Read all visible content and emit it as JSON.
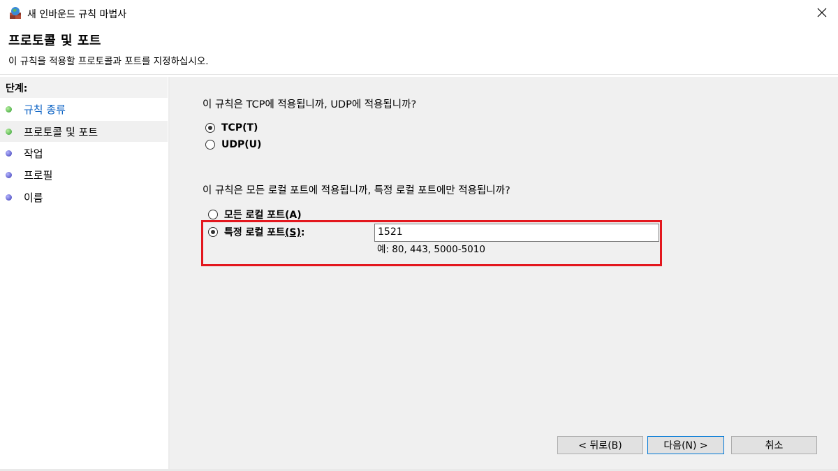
{
  "window": {
    "title": "새 인바운드 규칙 마법사",
    "close_label": "✕"
  },
  "header": {
    "title": "프로토콜 및 포트",
    "subtitle": "이 규칙을 적용할 프로토콜과 포트를 지정하십시오."
  },
  "steps": {
    "label": "단계:",
    "items": [
      {
        "label": "규칙 종류",
        "status": "done",
        "color": "green"
      },
      {
        "label": "프로토콜 및 포트",
        "status": "current",
        "color": "green"
      },
      {
        "label": "작업",
        "status": "pending",
        "color": "blue"
      },
      {
        "label": "프로필",
        "status": "pending",
        "color": "blue"
      },
      {
        "label": "이름",
        "status": "pending",
        "color": "blue"
      }
    ]
  },
  "protocol": {
    "question": "이 규칙은 TCP에 적용됩니까, UDP에 적용됩니까?",
    "tcp_label": "TCP(T)",
    "udp_label": "UDP(U)",
    "selected": "TCP"
  },
  "ports": {
    "question": "이 규칙은 모든 로컬 포트에 적용됩니까, 특정 로컬 포트에만 적용됩니까?",
    "all_label_prefix": "모든 로컬 포트",
    "all_label_key": "(A)",
    "specific_label_prefix": "특정 로컬 포트",
    "specific_label_key": "(S)",
    "specific_label_suffix": ":",
    "selected": "specific",
    "value": "1521",
    "example": "예: 80, 443, 5000-5010"
  },
  "buttons": {
    "back": "< 뒤로(B)",
    "next": "다음(N) >",
    "cancel": "취소"
  },
  "colors": {
    "highlight": "#e3171e",
    "link": "#0b62c4",
    "content_bg": "#f0f0f0"
  }
}
